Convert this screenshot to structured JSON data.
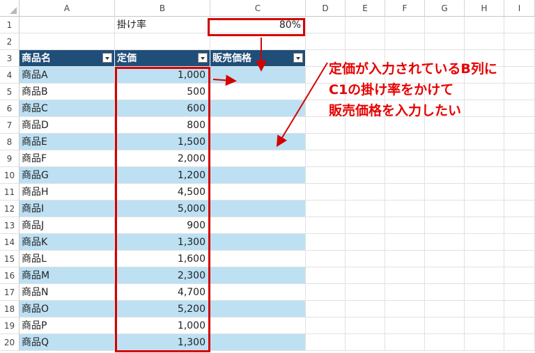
{
  "columns": [
    "A",
    "B",
    "C",
    "D",
    "E",
    "F",
    "G",
    "H",
    "I"
  ],
  "row_numbers": [
    "1",
    "2",
    "3",
    "4",
    "5",
    "6",
    "7",
    "8",
    "9",
    "10",
    "11",
    "12",
    "13",
    "14",
    "15",
    "16",
    "17",
    "18",
    "19",
    "20"
  ],
  "row1": {
    "label": "掛け率",
    "rate": "80%"
  },
  "table": {
    "headers": [
      "商品名",
      "定価",
      "販売価格"
    ],
    "rows": [
      {
        "name": "商品A",
        "price": "1,000"
      },
      {
        "name": "商品B",
        "price": "500"
      },
      {
        "name": "商品C",
        "price": "600"
      },
      {
        "name": "商品D",
        "price": "800"
      },
      {
        "name": "商品E",
        "price": "1,500"
      },
      {
        "name": "商品F",
        "price": "2,000"
      },
      {
        "name": "商品G",
        "price": "1,200"
      },
      {
        "name": "商品H",
        "price": "4,500"
      },
      {
        "name": "商品I",
        "price": "5,000"
      },
      {
        "name": "商品J",
        "price": "900"
      },
      {
        "name": "商品K",
        "price": "1,300"
      },
      {
        "name": "商品L",
        "price": "1,600"
      },
      {
        "name": "商品M",
        "price": "2,300"
      },
      {
        "name": "商品N",
        "price": "4,700"
      },
      {
        "name": "商品O",
        "price": "5,200"
      },
      {
        "name": "商品P",
        "price": "1,000"
      },
      {
        "name": "商品Q",
        "price": "1,300"
      }
    ]
  },
  "annotation": {
    "lines": [
      "定価が入力されているB列に",
      "C1の掛け率をかけて",
      "販売価格を入力したい"
    ]
  },
  "colors": {
    "header_fill": "#1f4e78",
    "band_fill": "#bde0f3",
    "highlight": "#d40000",
    "annotation_text": "#e60000"
  }
}
